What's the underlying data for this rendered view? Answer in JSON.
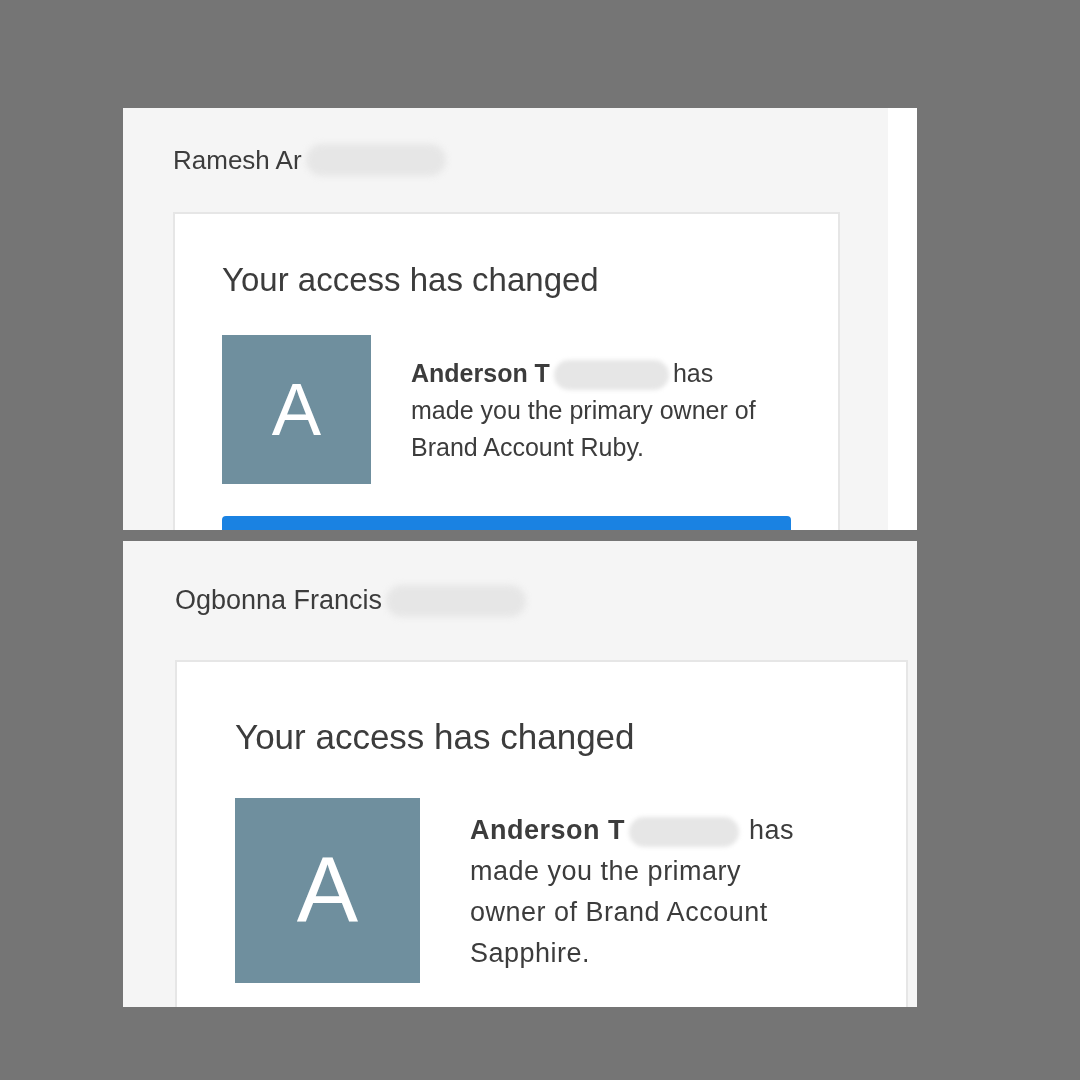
{
  "panels": [
    {
      "recipient": "Ramesh Ar",
      "title": "Your access has changed",
      "avatar_letter": "A",
      "sender": "Anderson T",
      "message": "has made you the primary owner of Brand Account Ruby.",
      "button_visible": true
    },
    {
      "recipient": "Ogbonna Francis",
      "title": "Your access has changed",
      "avatar_letter": "A",
      "sender": "Anderson T",
      "message": "has made you the primary owner of Brand Account Sapphire."
    }
  ]
}
